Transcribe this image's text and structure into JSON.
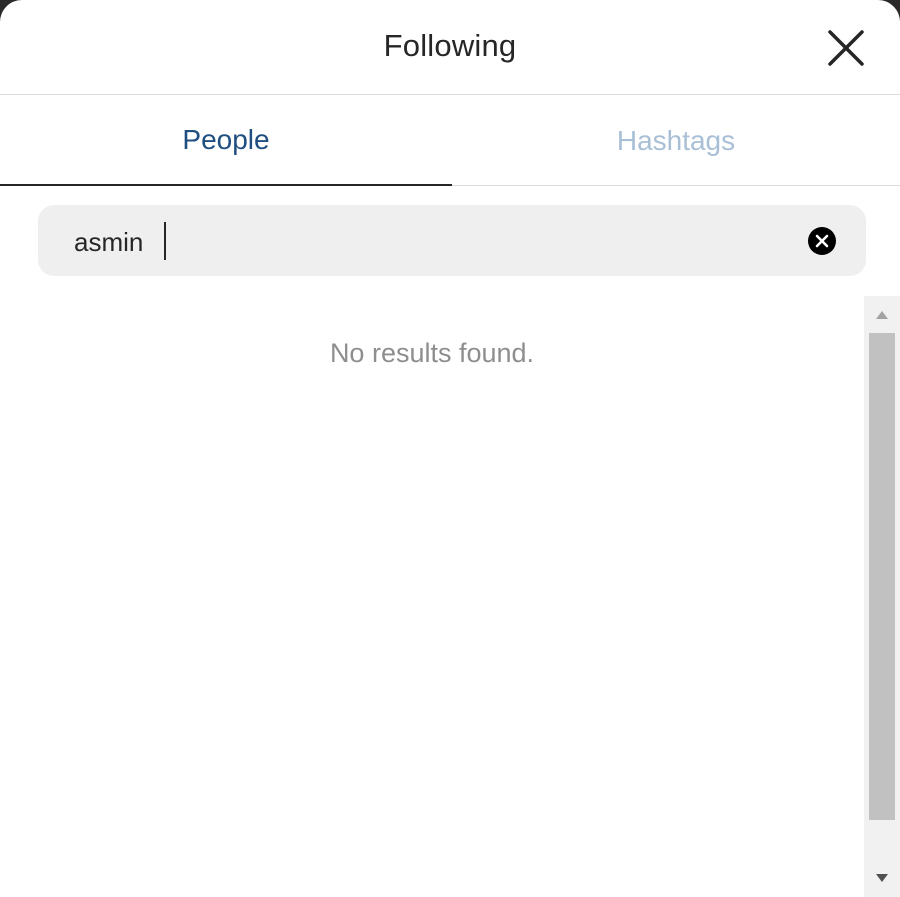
{
  "dialog": {
    "title": "Following",
    "close_icon": "close-icon"
  },
  "tabs": [
    {
      "label": "People",
      "active": true
    },
    {
      "label": "Hashtags",
      "active": false
    }
  ],
  "search": {
    "value": "asmin",
    "clear_icon": "clear-circle-icon"
  },
  "results": {
    "empty_message": "No results found."
  },
  "colors": {
    "active_tab_text": "#1f4f80",
    "inactive_tab_text": "#a9bfd6",
    "search_background": "#efefef",
    "muted_text": "#8e8e8e"
  }
}
